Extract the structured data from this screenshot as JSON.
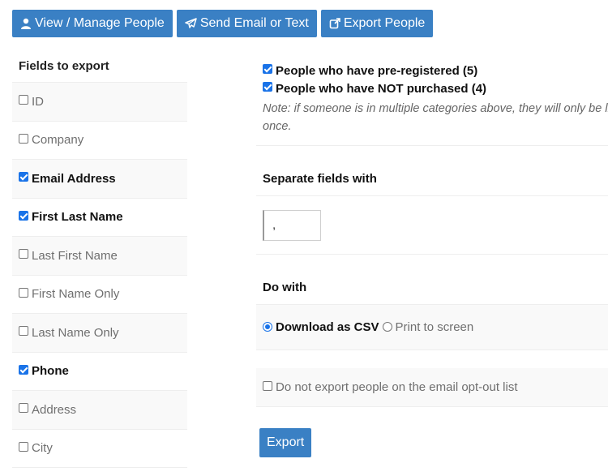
{
  "toolbar": {
    "view_manage_label": "View / Manage People",
    "send_email_label": "Send Email or Text",
    "export_people_label": "Export People"
  },
  "fields": {
    "heading": "Fields to export",
    "items": [
      {
        "label": "ID",
        "checked": false
      },
      {
        "label": "Company",
        "checked": false
      },
      {
        "label": "Email Address",
        "checked": true
      },
      {
        "label": "First Last Name",
        "checked": true
      },
      {
        "label": "Last First Name",
        "checked": false
      },
      {
        "label": "First Name Only",
        "checked": false
      },
      {
        "label": "Last Name Only",
        "checked": false
      },
      {
        "label": "Phone",
        "checked": true
      },
      {
        "label": "Address",
        "checked": false
      },
      {
        "label": "City",
        "checked": false
      }
    ]
  },
  "filters": {
    "preregistered_label": "People who have pre-registered (5)",
    "not_purchased_label": "People who have NOT purchased (4)",
    "note_line1": "Note: if someone is in multiple categories above, they will only be listed",
    "note_line2": "once."
  },
  "separator": {
    "heading": "Separate fields with",
    "value": ","
  },
  "dowith": {
    "heading": "Do with",
    "download_label": "Download as CSV",
    "print_label": "Print to screen"
  },
  "optout_label": "Do not export people on the email opt-out list",
  "export_button_label": "Export",
  "colors": {
    "accent": "#3a80c4",
    "checkbox": "#1a73e8"
  }
}
